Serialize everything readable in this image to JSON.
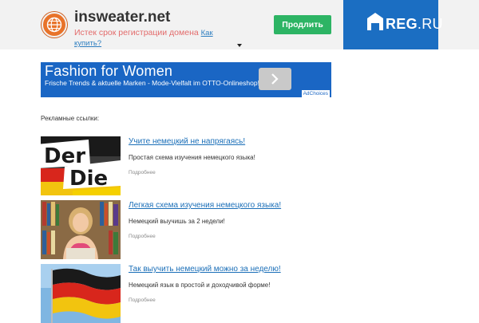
{
  "header": {
    "domain": "insweater.net",
    "expired_text": "Истек срок регистрации домена",
    "how_to_buy": "Как купить?",
    "renew_button": "Продлить",
    "registrar_logo": {
      "name": "REG",
      "suffix": ".RU"
    },
    "colors": {
      "renew": "#2db464",
      "registrar": "#1b6ec2",
      "expired": "#e36b6b"
    }
  },
  "banner": {
    "title": "Fashion for Women",
    "subtitle": "Frische Trends & aktuelle Marken - Mode-Vielfalt im OTTO-Onlineshop!",
    "adchoices": "AdChoices",
    "next_icon": "chevron-right-icon",
    "color": "#1a66c4"
  },
  "ads_label": "Рекламные ссылки:",
  "ads": [
    {
      "title": "Учите немецкий не напрягаясь!",
      "description": "Простая схема изучения немецкого языка!",
      "more": "Подробнее",
      "image": "der-die-das-image"
    },
    {
      "title": "Легкая схема изучения немецкого языка!",
      "description": "Немецкий выучишь за 2 недели!",
      "more": "Подробнее",
      "image": "student-library-image"
    },
    {
      "title": "Так выучить немецкий можно за неделю!",
      "description": "Немецкий язык в простой и доходчивой форме!",
      "more": "Подробнее",
      "image": "german-flag-image"
    }
  ]
}
